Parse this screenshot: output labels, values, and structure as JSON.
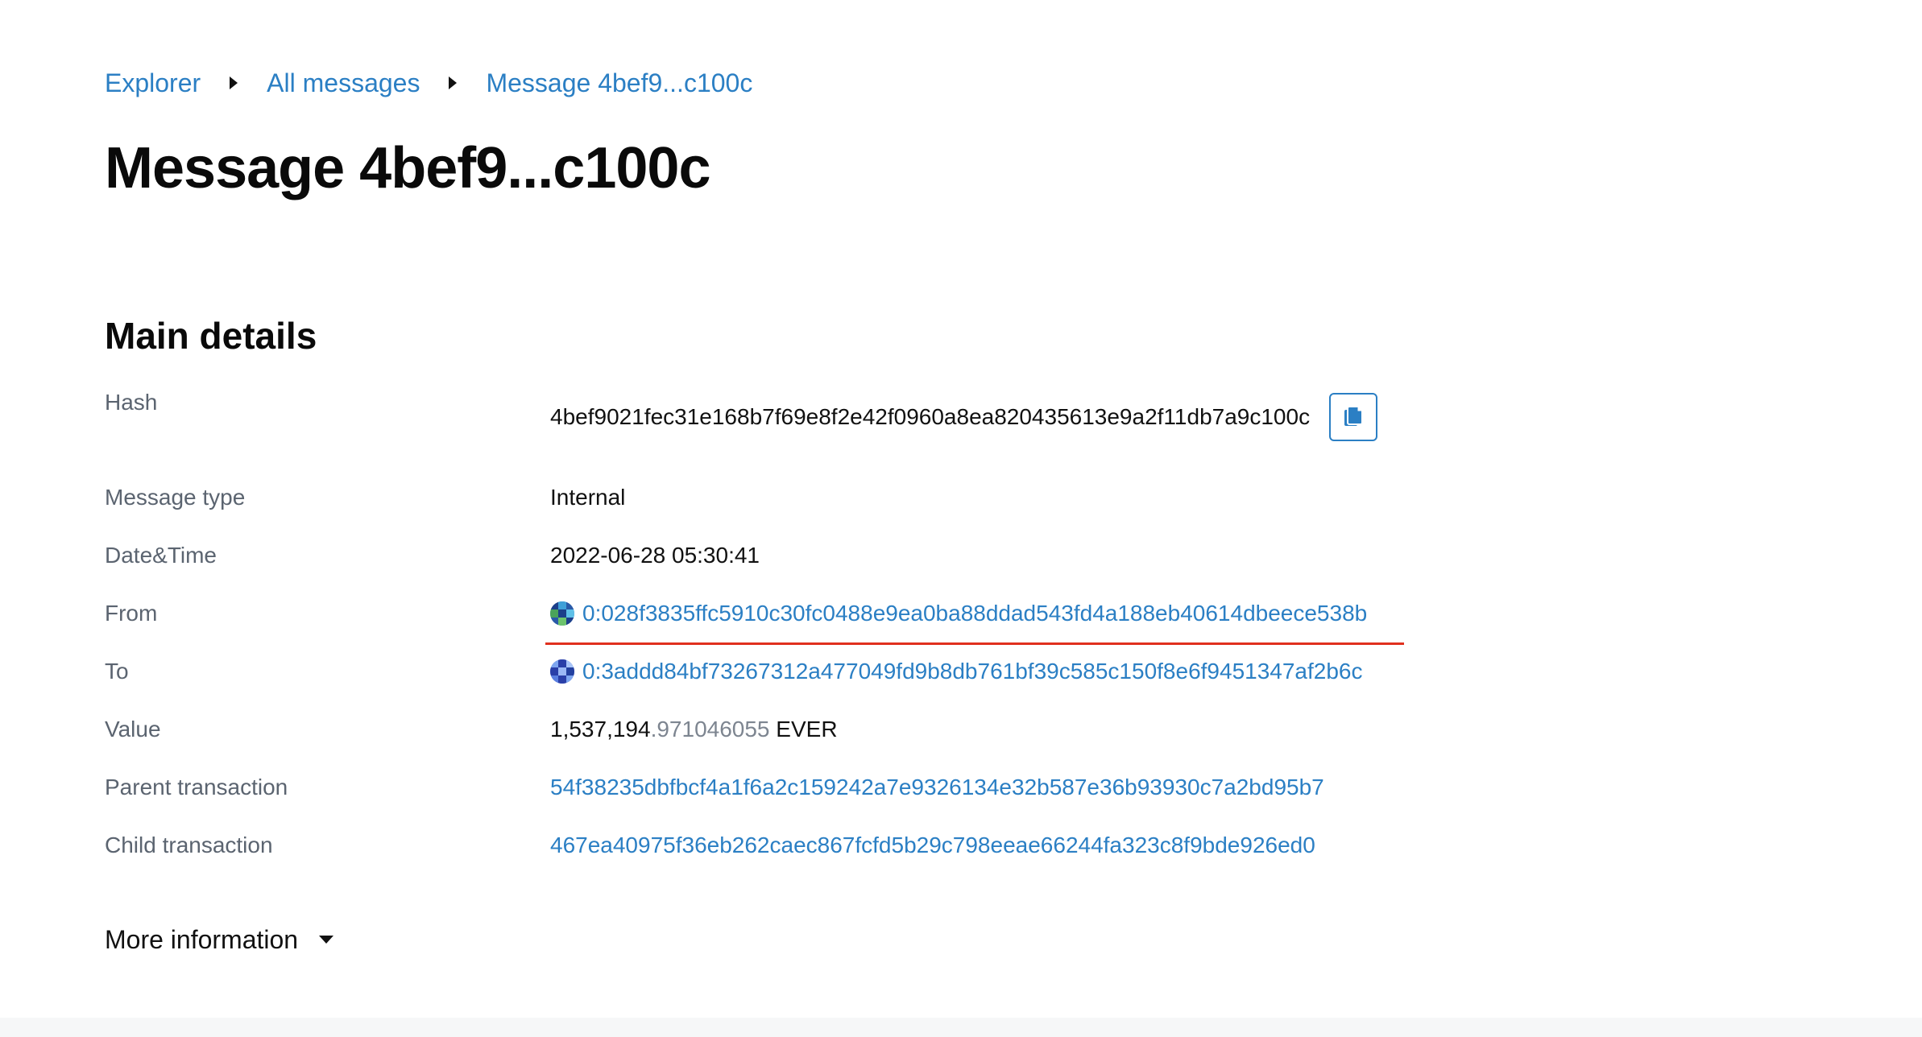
{
  "breadcrumb": {
    "items": [
      "Explorer",
      "All messages",
      "Message 4bef9...c100c"
    ]
  },
  "page": {
    "title": "Message 4bef9...c100c"
  },
  "main_details": {
    "title": "Main details",
    "hash": {
      "label": "Hash",
      "value": "4bef9021fec31e168b7f69e8f2e42f0960a8ea820435613e9a2f11db7a9c100c",
      "copy_icon": "copy-icon"
    },
    "message_type": {
      "label": "Message type",
      "value": "Internal"
    },
    "datetime": {
      "label": "Date&Time",
      "value": "2022-06-28 05:30:41"
    },
    "from": {
      "label": "From",
      "value": "0:028f3835ffc5910c30fc0488e9ea0ba88ddad543fd4a188eb40614dbeece538b"
    },
    "to": {
      "label": "To",
      "value": "0:3addd84bf73267312a477049fd9b8db761bf39c585c150f8e6f9451347af2b6c"
    },
    "value": {
      "label": "Value",
      "integer": "1,537,194",
      "fraction": ".971046055",
      "unit": "EVER"
    },
    "parent_transaction": {
      "label": "Parent transaction",
      "value": "54f38235dbfbcf4a1f6a2c159242a7e9326134e32b587e36b93930c7a2bd95b7"
    },
    "child_transaction": {
      "label": "Child transaction",
      "value": "467ea40975f36eb262caec867fcfd5b29c798eeae66244fa323c8f9bde926ed0"
    }
  },
  "more_information": {
    "label": "More information"
  },
  "colors": {
    "link": "#2b7fc4",
    "highlight": "#e0301e",
    "label": "#5b6470"
  }
}
